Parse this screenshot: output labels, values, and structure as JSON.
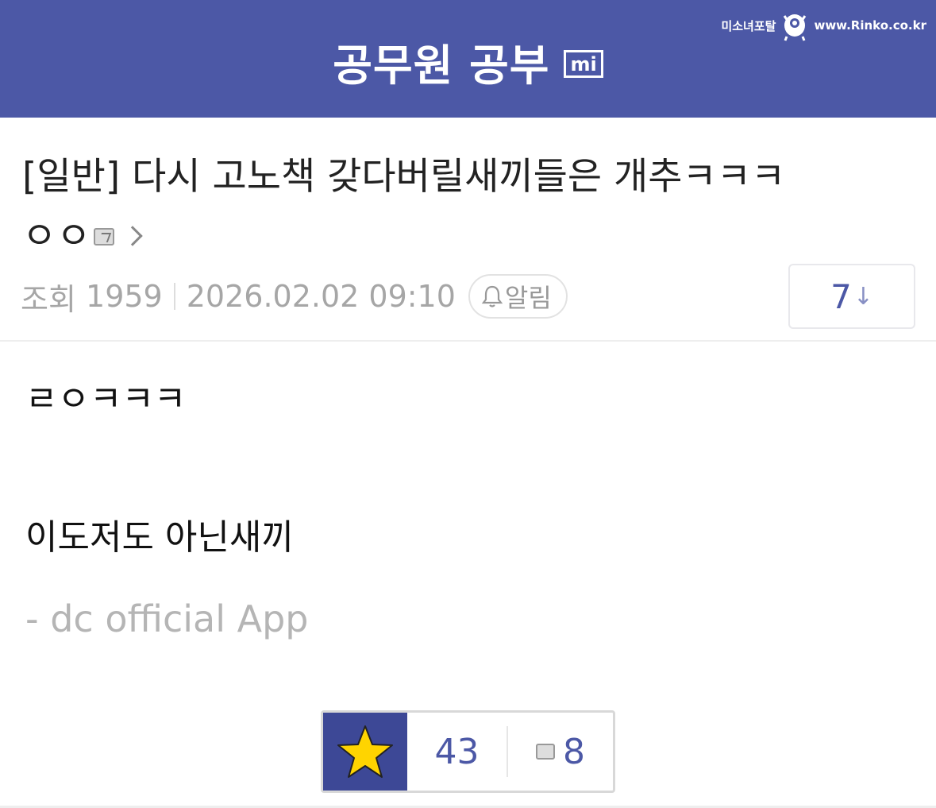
{
  "header": {
    "title": "공무원 공부",
    "badge": "mi",
    "watermark_brand": "미소녀포탈",
    "watermark_url": "www.Rinko.co.kr",
    "bg_color": "#4c58a6"
  },
  "post": {
    "title_line1": "[일반] 다시 고노책 갖다버릴새끼들은 개추ㅋㅋㅋ",
    "title_line2": "ㅇㅇ",
    "views_label": "조회",
    "views": "1959",
    "datetime": "2026.02.02 09:10",
    "alarm_label": "알림",
    "comment_count": "7",
    "comment_arrow": "↓"
  },
  "body": {
    "line1": "ㄹㅇㅋㅋㅋ",
    "line2": "이도저도 아닌새끼",
    "signature": "- dc official App"
  },
  "recommend": {
    "count": "43",
    "comments": "8",
    "star_color": "#ffd400"
  }
}
